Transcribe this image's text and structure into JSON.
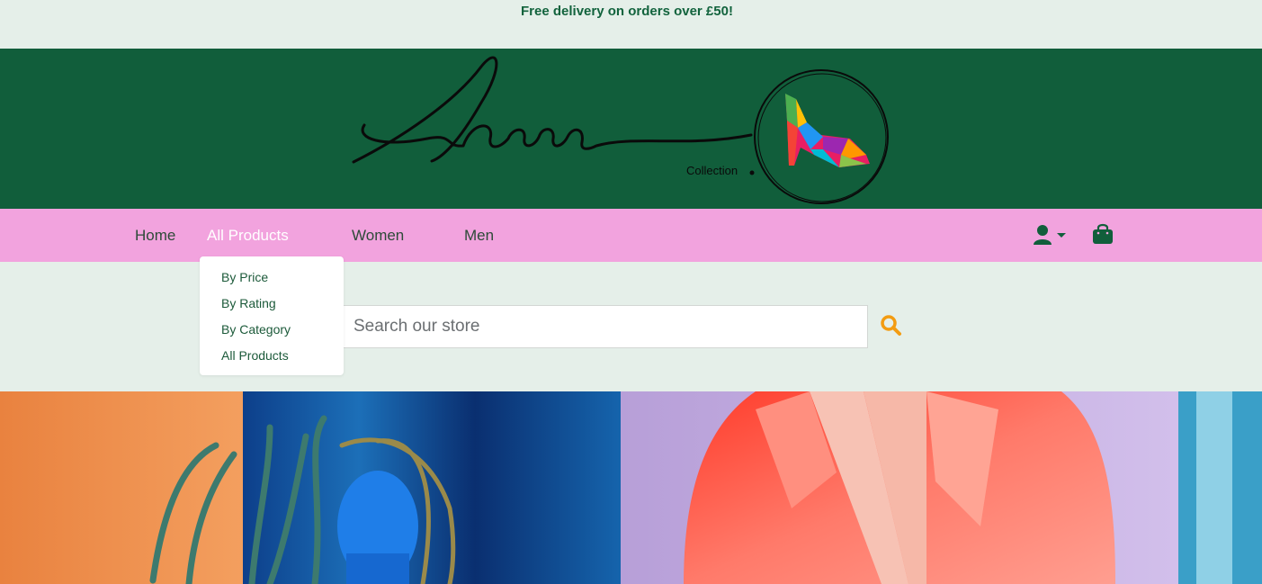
{
  "announcement": {
    "text": "Free delivery on orders over £50!"
  },
  "brand": {
    "name": "Sarah",
    "tagline": "Collection"
  },
  "nav": {
    "home": "Home",
    "all_products": "All Products",
    "women": "Women",
    "men": "Men",
    "account_icon": "user-icon",
    "bag_icon": "shopping-bag-icon"
  },
  "dropdown": {
    "items": [
      "By Price",
      "By Rating",
      "By Category",
      "All Products"
    ]
  },
  "search": {
    "placeholder": "Search our store",
    "icon": "search-icon"
  },
  "colors": {
    "banner": "#115e3b",
    "nav": "#f2a3de",
    "background": "#e5efe9",
    "accent": "#f39c12",
    "brand_text": "#12633d"
  }
}
